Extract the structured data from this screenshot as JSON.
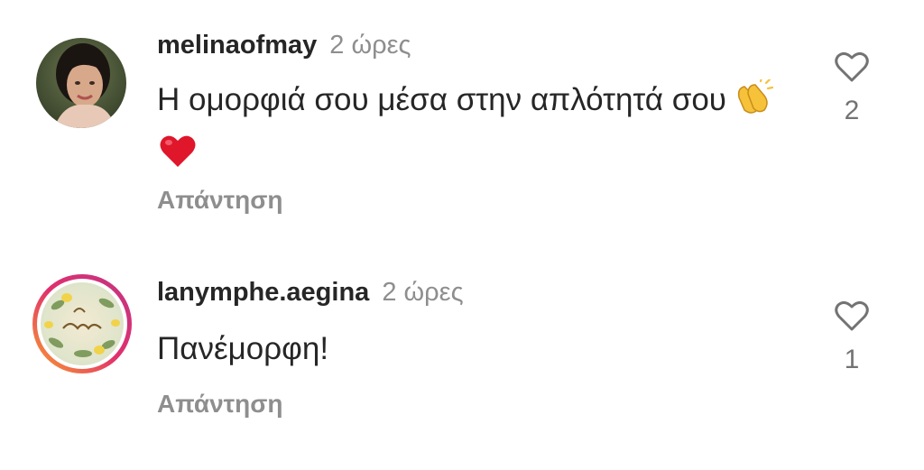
{
  "comments": [
    {
      "username": "melinaofmay",
      "time": "2 ώρες",
      "text": "Η ομορφιά σου μέσα στην απλότητά σου",
      "emojis": [
        "clapping-hands-icon",
        "red-heart-icon"
      ],
      "reply_label": "Απάντηση",
      "like_count": "2"
    },
    {
      "username": "lanymphe.aegina",
      "time": "2 ώρες",
      "text": "Πανέμορφη!",
      "reply_label": "Απάντηση",
      "like_count": "1"
    }
  ],
  "colors": {
    "text_primary": "#262626",
    "text_secondary": "#8e8e8e",
    "story_ring_start": "#f9a12e",
    "story_ring_end": "#c13584"
  }
}
